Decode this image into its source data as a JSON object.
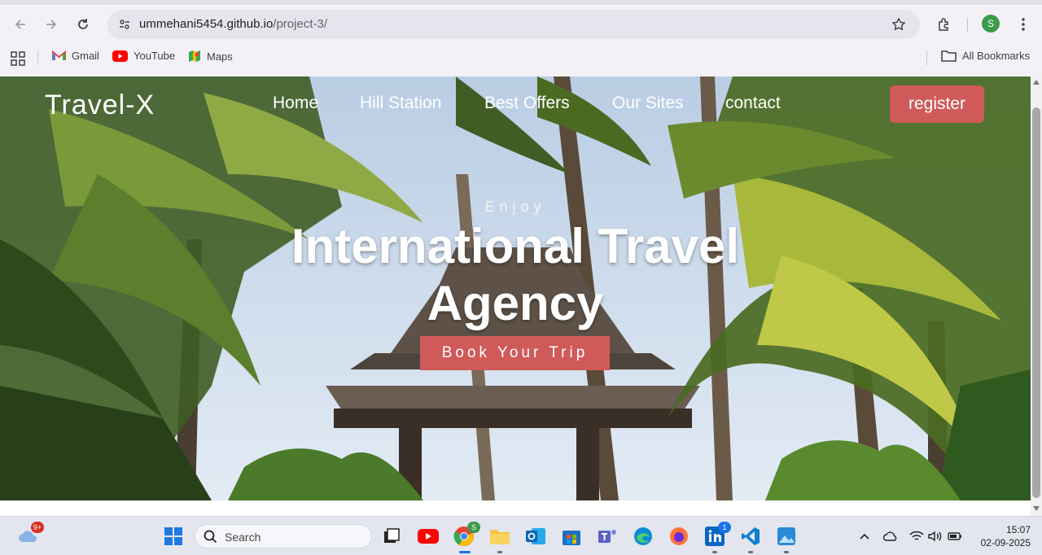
{
  "browser": {
    "url_host": "ummehani5454.github.io",
    "url_path": "/project-3/",
    "profile_initial": "S",
    "bookmarks": [
      {
        "label": "Gmail",
        "icon": "gmail-icon"
      },
      {
        "label": "YouTube",
        "icon": "youtube-icon"
      },
      {
        "label": "Maps",
        "icon": "maps-icon"
      }
    ],
    "all_bookmarks_label": "All Bookmarks"
  },
  "site": {
    "brand": "Travel-X",
    "nav": [
      {
        "label": "Home"
      },
      {
        "label": "Hill Station"
      },
      {
        "label": "Best Offers"
      },
      {
        "label": "Our Sites"
      },
      {
        "label": "contact"
      }
    ],
    "register_label": "register",
    "hero": {
      "kicker": "Enjoy",
      "headline": "International Travel Agency",
      "cta_label": "Book Your Trip"
    },
    "colors": {
      "accent": "#d05a5a"
    }
  },
  "taskbar": {
    "search_placeholder": "Search",
    "weather_badge": "9+",
    "chrome_badge": "S",
    "linkedin_badge": "1",
    "time": "15:07",
    "date": "02-09-2025"
  }
}
